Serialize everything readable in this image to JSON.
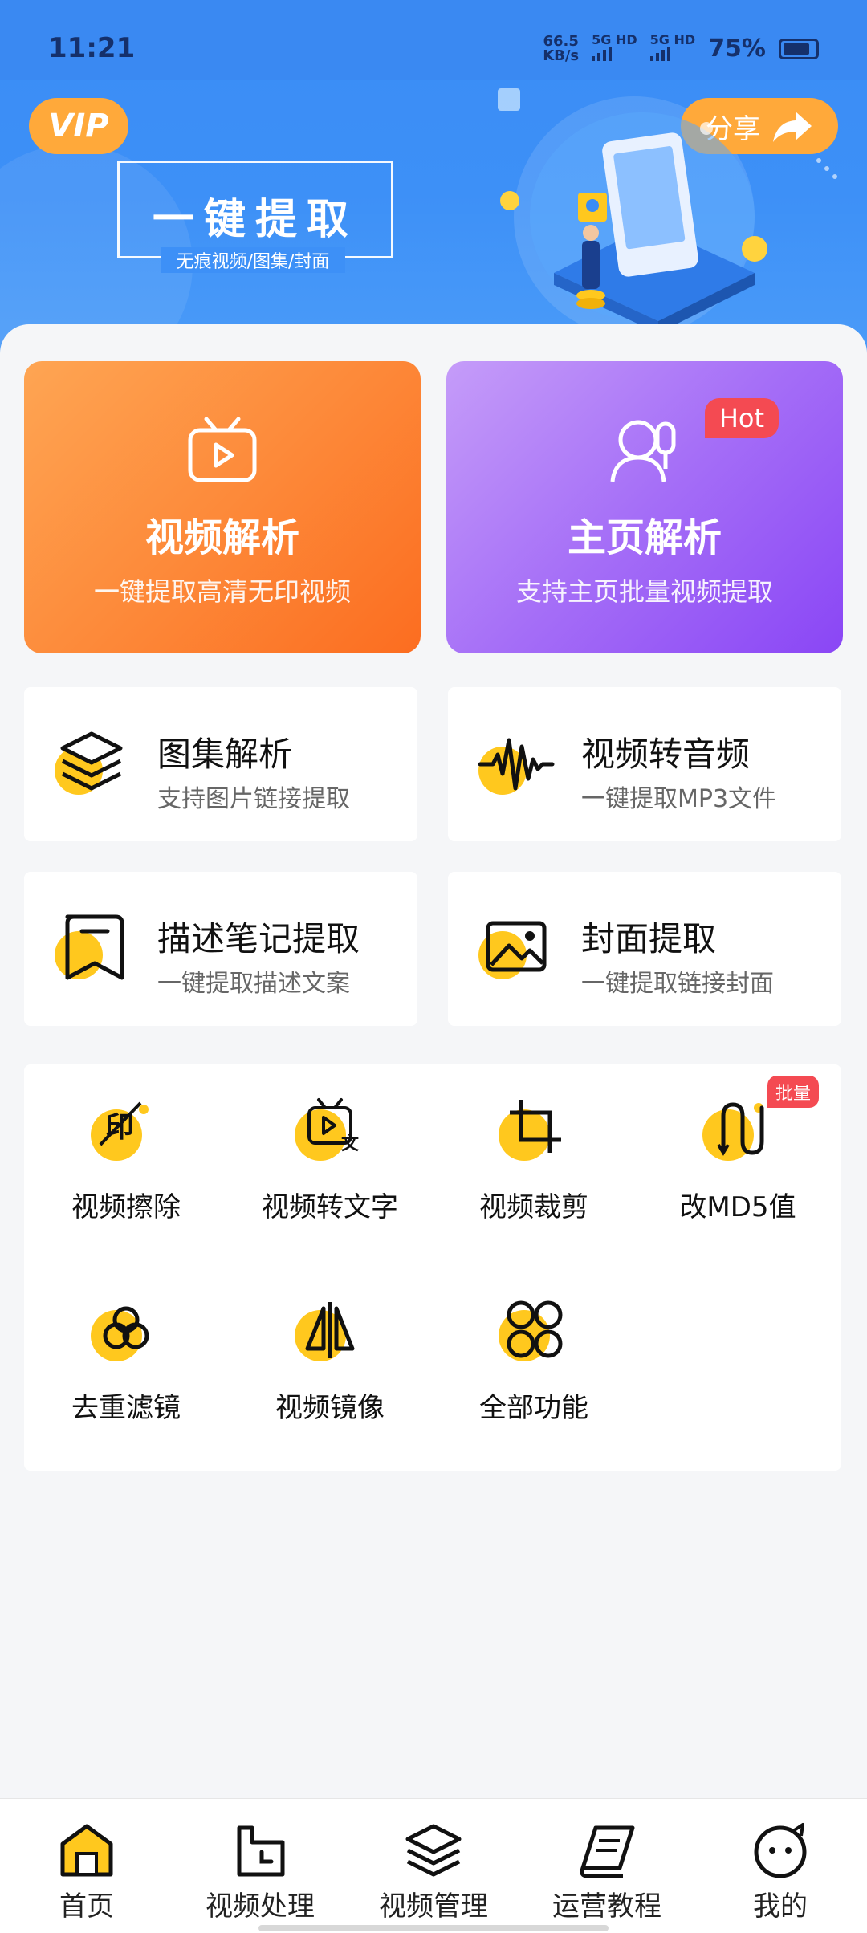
{
  "status_bar": {
    "time": "11:21",
    "net_speed_value": "66.5",
    "net_speed_unit": "KB/s",
    "sim1": "5G HD",
    "sim2": "5G HD",
    "battery": "75%"
  },
  "banner": {
    "vip_label": "VIP",
    "share_label": "分享",
    "title": "一键提取",
    "subtitle": "无痕视频/图集/封面"
  },
  "main_cards": [
    {
      "title": "视频解析",
      "subtitle": "一键提取高清无印视频",
      "icon": "tv-play-icon"
    },
    {
      "title": "主页解析",
      "subtitle": "支持主页批量视频提取",
      "icon": "user-profile-icon",
      "badge": "Hot"
    }
  ],
  "features": [
    {
      "title": "图集解析",
      "subtitle": "支持图片链接提取",
      "icon": "layers-icon"
    },
    {
      "title": "视频转音频",
      "subtitle": "一键提取MP3文件",
      "icon": "audio-wave-icon"
    },
    {
      "title": "描述笔记提取",
      "subtitle": "一键提取描述文案",
      "icon": "note-icon"
    },
    {
      "title": "封面提取",
      "subtitle": "一键提取链接封面",
      "icon": "image-icon"
    }
  ],
  "tools": [
    {
      "label": "视频擦除",
      "icon": "erase-watermark-icon"
    },
    {
      "label": "视频转文字",
      "icon": "video-to-text-icon"
    },
    {
      "label": "视频裁剪",
      "icon": "crop-icon"
    },
    {
      "label": "改MD5值",
      "icon": "md5-icon",
      "badge": "批量"
    },
    {
      "label": "去重滤镜",
      "icon": "filter-icon"
    },
    {
      "label": "视频镜像",
      "icon": "mirror-icon"
    },
    {
      "label": "全部功能",
      "icon": "all-functions-icon"
    }
  ],
  "bottom_nav": [
    {
      "label": "首页",
      "icon": "home-icon",
      "active": true
    },
    {
      "label": "视频处理",
      "icon": "video-process-icon"
    },
    {
      "label": "视频管理",
      "icon": "layers-icon"
    },
    {
      "label": "运营教程",
      "icon": "book-icon"
    },
    {
      "label": "我的",
      "icon": "profile-face-icon"
    }
  ],
  "colors": {
    "header_blue": "#3a8cf5",
    "accent_orange": "#ffa93a",
    "accent_yellow": "#ffc81e",
    "hot_red": "#f44a52",
    "purple": "#9a5cf6"
  }
}
